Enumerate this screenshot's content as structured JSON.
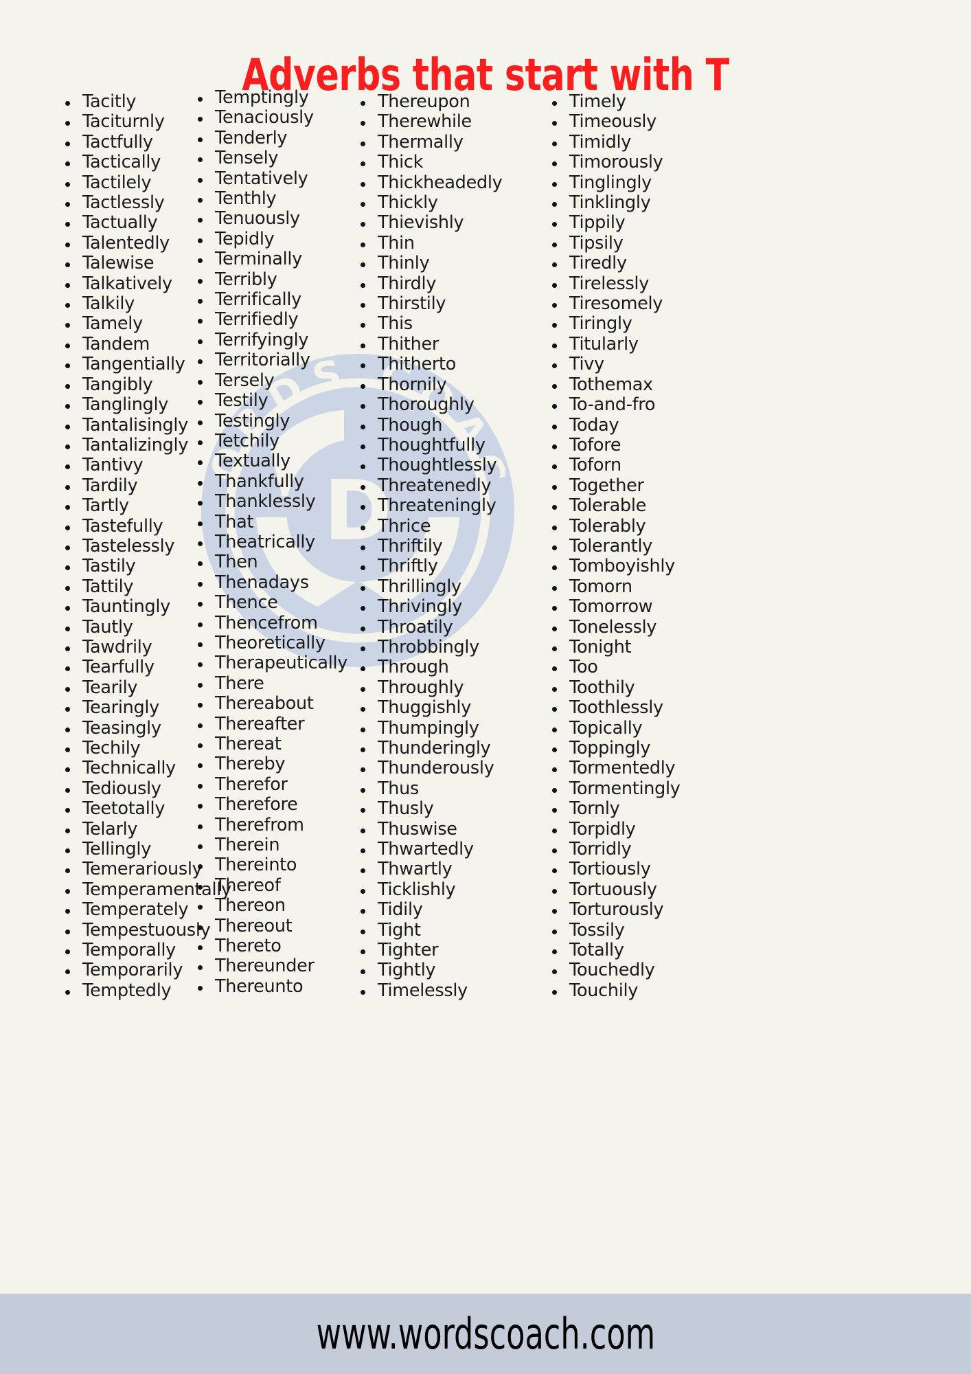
{
  "header": {
    "title": "Adverbs that start with T",
    "title_color": "#fa1e1e"
  },
  "theme": {
    "background": "#f4f4ec",
    "text_color": "#1a1a1a",
    "footer_background": "#c4ccda",
    "watermark_color": "#ccd5e6"
  },
  "watermark": {
    "name": "words-coach-logo",
    "text_top": "WORDS COACH",
    "text_center": "D"
  },
  "footer": {
    "url": "www.wordscoach.com"
  },
  "columns": [
    {
      "name": "column-1",
      "words": [
        "Tacitly",
        "Taciturnly",
        "Tactfully",
        "Tactically",
        "Tactilely",
        "Tactlessly",
        "Tactually",
        "Talentedly",
        "Talewise",
        "Talkatively",
        "Talkily",
        "Tamely",
        "Tandem",
        "Tangentially",
        "Tangibly",
        "Tanglingly",
        "Tantalisingly",
        "Tantalizingly",
        "Tantivy",
        "Tardily",
        "Tartly",
        "Tastefully",
        "Tastelessly",
        "Tastily",
        "Tattily",
        "Tauntingly",
        "Tautly",
        "Tawdrily",
        "Tearfully",
        "Tearily",
        "Tearingly",
        "Teasingly",
        "Techily",
        "Technically",
        "Tediously",
        "Teetotally",
        "Telarly",
        "Tellingly",
        "Temerariously",
        "Temperamentally",
        "Temperately",
        "Tempestuously",
        "Temporally",
        "Temporarily",
        "Temptedly"
      ]
    },
    {
      "name": "column-2",
      "words": [
        "Temptingly",
        "Tenaciously",
        "Tenderly",
        "Tensely",
        "Tentatively",
        "Tenthly",
        "Tenuously",
        "Tepidly",
        "Terminally",
        "Terribly",
        "Terrifically",
        "Terrifiedly",
        "Terrifyingly",
        "Territorially",
        "Tersely",
        "Testily",
        "Testingly",
        "Tetchily",
        "Textually",
        "Thankfully",
        "Thanklessly",
        "That",
        "Theatrically",
        "Then",
        "Thenadays",
        "Thence",
        "Thencefrom",
        "Theoretically",
        "Therapeutically",
        "There",
        "Thereabout",
        "Thereafter",
        "Thereat",
        "Thereby",
        "Therefor",
        "Therefore",
        "Therefrom",
        "Therein",
        "Thereinto",
        "Thereof",
        "Thereon",
        "Thereout",
        "Thereto",
        "Thereunder",
        "Thereunto"
      ]
    },
    {
      "name": "column-3",
      "words": [
        "Thereupon",
        "Therewhile",
        "Thermally",
        "Thick",
        "Thickheadedly",
        "Thickly",
        "Thievishly",
        "Thin",
        "Thinly",
        "Thirdly",
        "Thirstily",
        "This",
        "Thither",
        "Thitherto",
        "Thornily",
        "Thoroughly",
        "Though",
        "Thoughtfully",
        "Thoughtlessly",
        "Threatenedly",
        "Threateningly",
        "Thrice",
        "Thriftily",
        "Thriftly",
        "Thrillingly",
        "Thrivingly",
        "Throatily",
        "Throbbingly",
        "Through",
        "Throughly",
        "Thuggishly",
        "Thumpingly",
        "Thunderingly",
        "Thunderously",
        "Thus",
        "Thusly",
        "Thuswise",
        "Thwartedly",
        "Thwartly",
        "Ticklishly",
        "Tidily",
        "Tight",
        "Tighter",
        "Tightly",
        "Timelessly"
      ]
    },
    {
      "name": "column-4",
      "words": [
        "Timely",
        "Timeously",
        "Timidly",
        "Timorously",
        "Tinglingly",
        "Tinklingly",
        "Tippily",
        "Tipsily",
        "Tiredly",
        "Tirelessly",
        "Tiresomely",
        "Tiringly",
        "Titularly",
        "Tivy",
        "Tothemax",
        "To-and-fro",
        "Today",
        "Tofore",
        "Toforn",
        "Together",
        "Tolerable",
        "Tolerably",
        "Tolerantly",
        "Tomboyishly",
        "Tomorn",
        "Tomorrow",
        "Tonelessly",
        "Tonight",
        "Too",
        "Toothily",
        "Toothlessly",
        "Topically",
        "Toppingly",
        "Tormentedly",
        "Tormentingly",
        "Tornly",
        "Torpidly",
        "Torridly",
        "Tortiously",
        "Tortuously",
        "Torturously",
        "Tossily",
        "Totally",
        "Touchedly",
        "Touchily"
      ]
    }
  ]
}
